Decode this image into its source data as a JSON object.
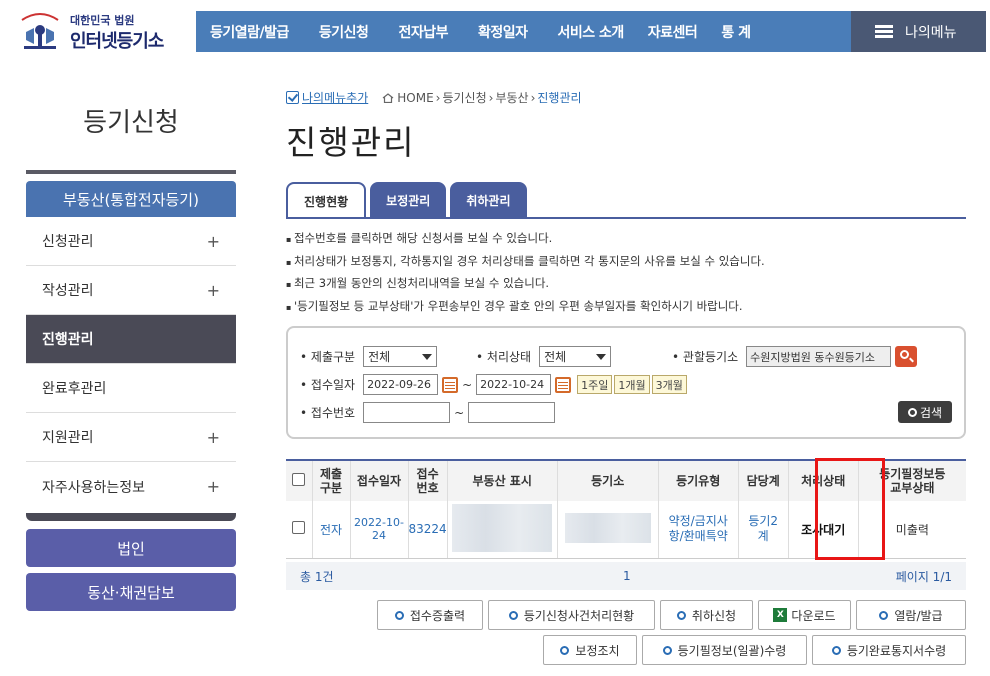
{
  "logo": {
    "small": "대한민국 법원",
    "big": "인터넷등기소"
  },
  "gnb": [
    "등기열람/발급",
    "등기신청",
    "전자납부",
    "확정일자",
    "서비스 소개",
    "자료센터",
    "통 계"
  ],
  "my_menu": "나의메뉴",
  "sidebar": {
    "title": "등기신청",
    "head": "부동산(통합전자등기)",
    "items": [
      {
        "label": "신청관리",
        "plus": "+"
      },
      {
        "label": "작성관리",
        "plus": "+"
      },
      {
        "label": "진행관리",
        "plus": ""
      },
      {
        "label": "완료후관리",
        "plus": ""
      },
      {
        "label": "지원관리",
        "plus": "+"
      },
      {
        "label": "자주사용하는정보",
        "plus": "+"
      }
    ],
    "btn1": "법인",
    "btn2": "동산·채권담보"
  },
  "breadcrumb": {
    "add": "나의메뉴추가",
    "home": "HOME",
    "p1": "등기신청",
    "p2": "부동산",
    "p3": "진행관리"
  },
  "page_title": "진행관리",
  "tabs": [
    "진행현황",
    "보정관리",
    "취하관리"
  ],
  "notes": [
    "접수번호를 클릭하면 해당 신청서를 보실 수 있습니다.",
    "처리상태가 보정통지, 각하통지일 경우 처리상태를 클릭하면 각 통지문의 사유를 보실 수 있습니다.",
    "최근 3개월 동안의 신청처리내역을 보실 수 있습니다.",
    "'등기필정보 등 교부상태'가 우편송부인 경우 괄호 안의 우편 송부일자를 확인하시기 바랍니다."
  ],
  "search": {
    "submit_label": "제출구분",
    "submit_value": "전체",
    "status_label": "처리상태",
    "status_value": "전체",
    "office_label": "관할등기소",
    "office_value": "수원지방법원 동수원등기소",
    "date_label": "접수일자",
    "date_from": "2022-09-26",
    "tilde": "~",
    "date_to": "2022-10-24",
    "periods": [
      "1주일",
      "1개월",
      "3개월"
    ],
    "num_label": "접수번호",
    "go": "검색"
  },
  "table": {
    "headers": [
      "제출\n구분",
      "접수일자",
      "접수\n번호",
      "부동산 표시",
      "등기소",
      "등기유형",
      "담당계",
      "처리상태",
      "등기필정보등\n교부상태"
    ],
    "rows": [
      {
        "submit": "전자",
        "date": "2022-10-24",
        "num": "83224",
        "type": "약정/금지사항/환매특약",
        "team": "등기2계",
        "status": "조사대기",
        "issue": "미출력"
      }
    ]
  },
  "footer": {
    "total": "총 1건",
    "page_num": "1",
    "page": "페이지 1/1"
  },
  "actions": [
    "접수증출력",
    "등기신청사건처리현황",
    "취하신청",
    "다운로드",
    "열람/발급",
    "보정조치",
    "등기필정보(일괄)수령",
    "등기완료통지서수령"
  ]
}
